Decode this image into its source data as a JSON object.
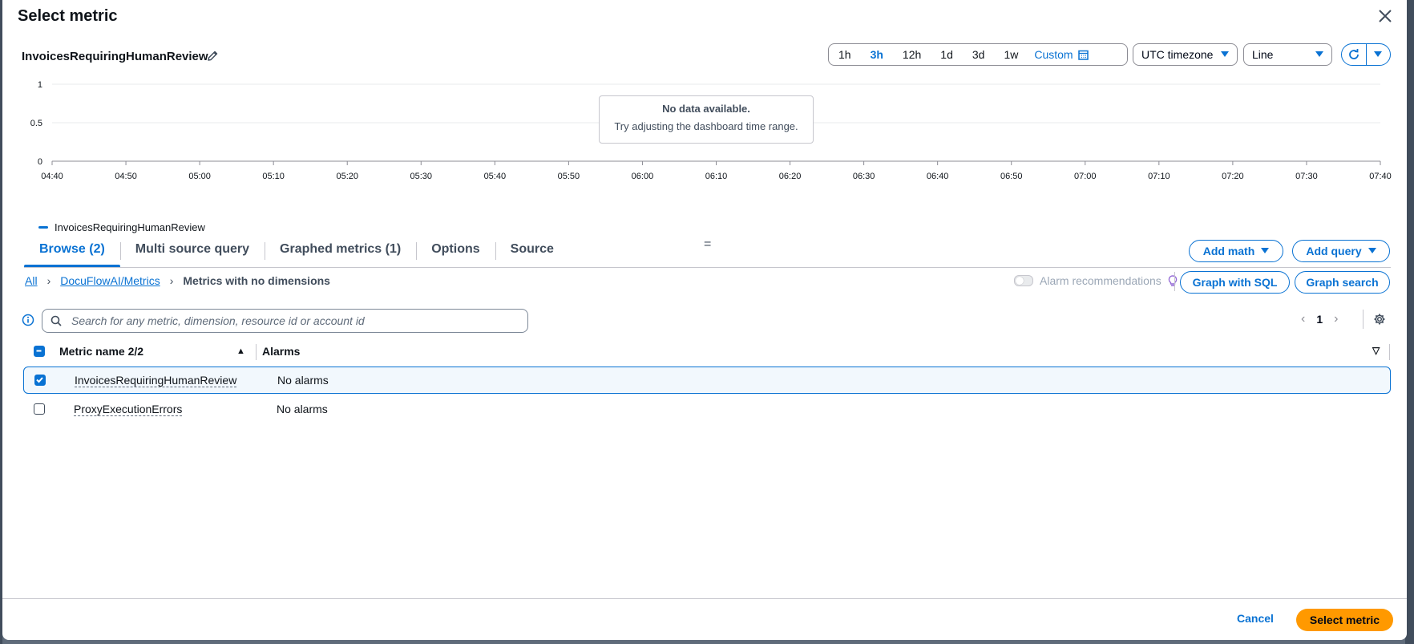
{
  "modal": {
    "title": "Select metric",
    "metric_title": "InvoicesRequiringHumanReview"
  },
  "toolbar": {
    "time_ranges": [
      "1h",
      "3h",
      "12h",
      "1d",
      "3d",
      "1w"
    ],
    "active_time_range": "3h",
    "custom_label": "Custom",
    "timezone": "UTC timezone",
    "chart_type": "Line"
  },
  "chart_data": {
    "type": "line",
    "x_ticks": [
      "04:40",
      "04:50",
      "05:00",
      "05:10",
      "05:20",
      "05:30",
      "05:40",
      "05:50",
      "06:00",
      "06:10",
      "06:20",
      "06:30",
      "06:40",
      "06:50",
      "07:00",
      "07:10",
      "07:20",
      "07:30",
      "07:40"
    ],
    "y_ticks": [
      "1",
      "0.5",
      "0"
    ],
    "ylim": [
      0,
      1
    ],
    "grid": true,
    "series": [
      {
        "name": "InvoicesRequiringHumanReview",
        "values": []
      }
    ],
    "no_data_title": "No data available.",
    "no_data_hint": "Try adjusting the dashboard time range.",
    "legend_position": "bottom-left",
    "series_color": "#0972d3"
  },
  "tabs": [
    {
      "label": "Browse (2)",
      "active": true
    },
    {
      "label": "Multi source query"
    },
    {
      "label": "Graphed metrics (1)"
    },
    {
      "label": "Options"
    },
    {
      "label": "Source"
    }
  ],
  "actions": {
    "add_math": "Add math",
    "add_query": "Add query",
    "graph_sql": "Graph with SQL",
    "graph_search": "Graph search",
    "alarm_recommendations": "Alarm recommendations"
  },
  "breadcrumb": {
    "all": "All",
    "namespace": "DocuFlowAI/Metrics",
    "current": "Metrics with no dimensions"
  },
  "search": {
    "placeholder": "Search for any metric, dimension, resource id or account id",
    "value": ""
  },
  "pagination": {
    "page": "1"
  },
  "table": {
    "col_name": "Metric name 2/2",
    "col_alarms": "Alarms",
    "rows": [
      {
        "name": "InvoicesRequiringHumanReview",
        "alarms": "No alarms",
        "checked": true
      },
      {
        "name": "ProxyExecutionErrors",
        "alarms": "No alarms",
        "checked": false
      }
    ]
  },
  "footer": {
    "cancel": "Cancel",
    "select": "Select metric"
  },
  "colors": {
    "accent": "#0972d3",
    "primary_button": "#ff9900"
  }
}
